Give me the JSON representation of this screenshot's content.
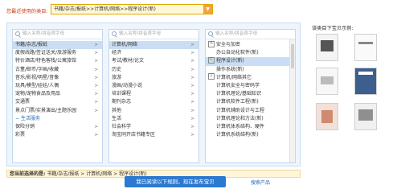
{
  "recent": {
    "label": "您最近使用的类目:",
    "value": "书籍/杂志/报纸>>计算机/网络>>程序设计(新)"
  },
  "search_placeholder": "输入名称/拼音首字母",
  "col1": {
    "items": [
      {
        "label": "书籍/杂志/报纸",
        "selected": true
      },
      {
        "label": "度假线路/签证送关/旅游服务"
      },
      {
        "label": "特价酒店/特色客栈/公寓旅馆"
      },
      {
        "label": "古董/邮币/字画/收藏"
      },
      {
        "label": "音乐/影视/明星/音像"
      },
      {
        "label": "玩具/模型/娃娃/人偶"
      },
      {
        "label": "宠物/宠物食品及用品"
      },
      {
        "label": "交通票"
      },
      {
        "label": "景点门票/实景演出/主题乐园"
      }
    ],
    "group_label": "生活服务",
    "more_items": [
      {
        "label": "保险分销"
      },
      {
        "label": "彩票"
      }
    ]
  },
  "col2": {
    "items": [
      {
        "label": "计算机/网络",
        "selected": true
      },
      {
        "label": "经济"
      },
      {
        "label": "考试/教材/论文"
      },
      {
        "label": "历史"
      },
      {
        "label": "旅游"
      },
      {
        "label": "漫画/动漫小说"
      },
      {
        "label": "培训课程"
      },
      {
        "label": "期刊杂志"
      },
      {
        "label": "其他"
      },
      {
        "label": "生活"
      },
      {
        "label": "社会科学"
      },
      {
        "label": "淘宝同开店书籍专区"
      }
    ]
  },
  "col3": {
    "items": [
      {
        "label": "安全与加密",
        "tag": "A"
      },
      {
        "label": "办公自动化软件(新)"
      },
      {
        "label": "程序设计(新)",
        "tag": "C",
        "selected": true
      },
      {
        "label": "操作系统(新)"
      },
      {
        "label": "计算机/网络其它",
        "tag": "J"
      },
      {
        "label": "计算机安全与密码学"
      },
      {
        "label": "计算机理论/基础知识"
      },
      {
        "label": "计算机软件工程(新)"
      },
      {
        "label": "计算机辅助设计与工程"
      },
      {
        "label": "计算机理论和方法(新)"
      },
      {
        "label": "计算机体系结构、硬件"
      },
      {
        "label": "计算机系统结构(新)"
      }
    ]
  },
  "preview_title": "该类目下宝贝示例:",
  "selected_label": "您当前选择的是:",
  "selected_path": "书籍/杂志/报纸 > 计算机/网络 > 程序设计(新)",
  "publish_label": "我已阅读以下规则，现在发布宝贝",
  "help_label": "搜索产品",
  "colors": {
    "accent": "#2b79d0",
    "selected_bg": "#c9def4",
    "recent": "#c8401a"
  }
}
